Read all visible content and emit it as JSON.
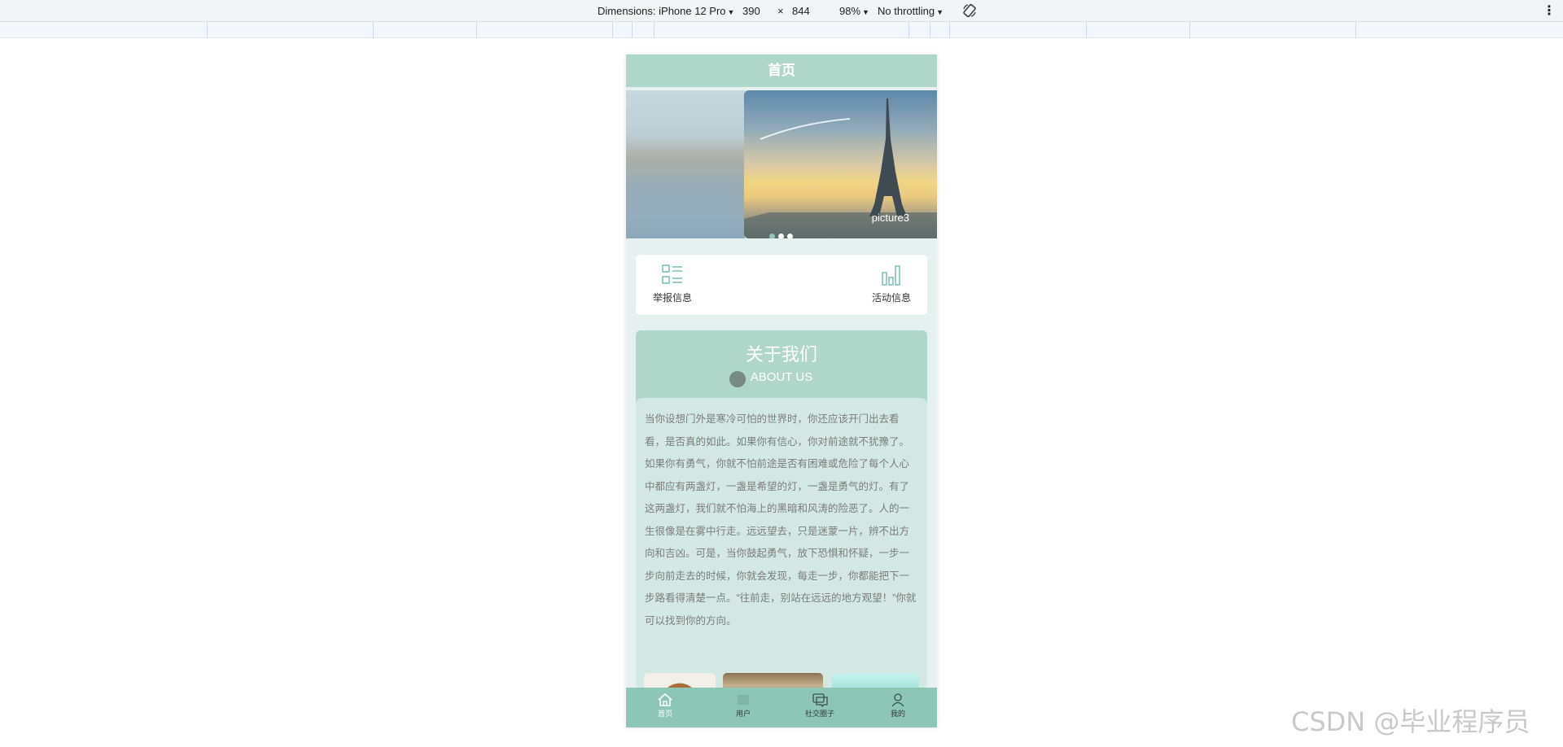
{
  "devtools": {
    "dimensions_label": "Dimensions: iPhone 12 Pro",
    "width_value": "390",
    "times": "×",
    "height_value": "844",
    "zoom": "98%",
    "throttling": "No throttling"
  },
  "app": {
    "title": "首页",
    "carousel": {
      "caption": "picture3",
      "slide_count": 3,
      "active_index": 0
    },
    "menu": [
      {
        "label": "举报信息",
        "icon": "list-grid-icon"
      },
      {
        "label": "活动信息",
        "icon": "bar-chart-icon"
      }
    ],
    "about": {
      "title": "关于我们",
      "subtitle": "ABOUT US",
      "text": "当你设想门外是寒冷可怕的世界时，你还应该开门出去看看，是否真的如此。如果你有信心，你对前途就不犹豫了。如果你有勇气，你就不怕前途是否有困难或危险了每个人心中都应有两盏灯，一盏是希望的灯，一盏是勇气的灯。有了这两盏灯，我们就不怕海上的黑暗和风涛的险恶了。人的一生很像是在雾中行走。远远望去，只是迷蒙一片，辨不出方向和吉凶。可是，当你鼓起勇气，放下恐惧和怀疑，一步一步向前走去的时候，你就会发现，每走一步，你都能把下一步路看得清楚一点。“往前走，别站在远远的地方观望！”你就可以找到你的方向。"
    },
    "tabs": [
      {
        "label": "首页",
        "icon": "home-icon",
        "active": true
      },
      {
        "label": "用户",
        "icon": "user-group-icon",
        "active": false
      },
      {
        "label": "社交圈子",
        "icon": "chat-icon",
        "active": false
      },
      {
        "label": "我的",
        "icon": "person-icon",
        "active": false
      }
    ]
  },
  "watermark": "CSDN @毕业程序员",
  "colors": {
    "primary": "#aed6c9",
    "tabbar": "#8cc6b4",
    "background": "#e6f0ee"
  }
}
